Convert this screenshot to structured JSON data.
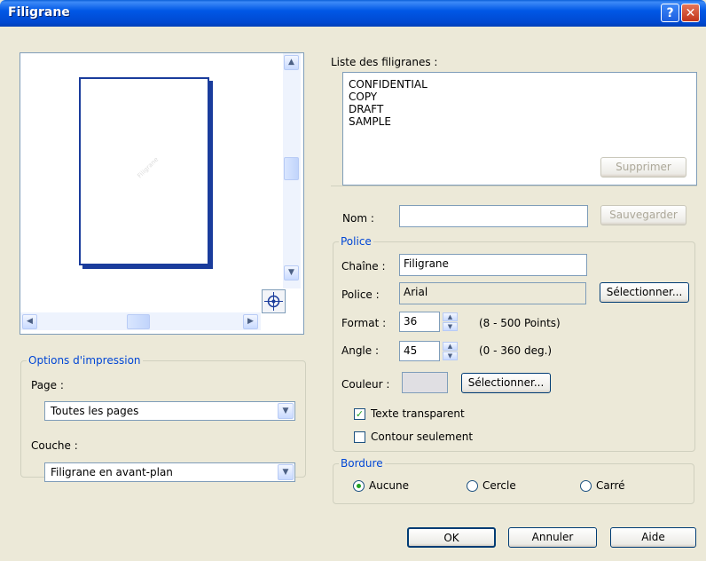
{
  "window": {
    "title": "Filigrane",
    "help_glyph": "?",
    "close_glyph": "✕"
  },
  "preview": {
    "watermark_mark": "Filigrane"
  },
  "print_options": {
    "group_label": "Options d'impression",
    "page_label": "Page :",
    "page_value": "Toutes les pages",
    "layer_label": "Couche :",
    "layer_value": "Filigrane en avant-plan"
  },
  "watermark_list": {
    "label": "Liste des filigranes :",
    "items": [
      "CONFIDENTIAL",
      "COPY",
      "DRAFT",
      "SAMPLE"
    ],
    "delete_button": "Supprimer"
  },
  "name": {
    "label": "Nom :",
    "value": "",
    "save_button": "Sauvegarder"
  },
  "font": {
    "group_label": "Police",
    "string_label": "Chaîne :",
    "string_value": "Filigrane",
    "font_label": "Police :",
    "font_value": "Arial",
    "select_button": "Sélectionner...",
    "size_label": "Format :",
    "size_value": "36",
    "size_range": "(8 - 500 Points)",
    "angle_label": "Angle :",
    "angle_value": "45",
    "angle_range": "(0 - 360 deg.)",
    "color_label": "Couleur :",
    "color_button": "Sélectionner...",
    "color_swatch": "#e0dfe3",
    "transparent_text_label": "Texte transparent",
    "transparent_text_checked": true,
    "outline_only_label": "Contour seulement",
    "outline_only_checked": false
  },
  "border": {
    "group_label": "Bordure",
    "options": [
      "Aucune",
      "Cercle",
      "Carré"
    ],
    "selected": "Aucune"
  },
  "footer": {
    "ok": "OK",
    "cancel": "Annuler",
    "help": "Aide"
  },
  "colors": {
    "accent": "#0046d5",
    "check": "#21a121"
  }
}
